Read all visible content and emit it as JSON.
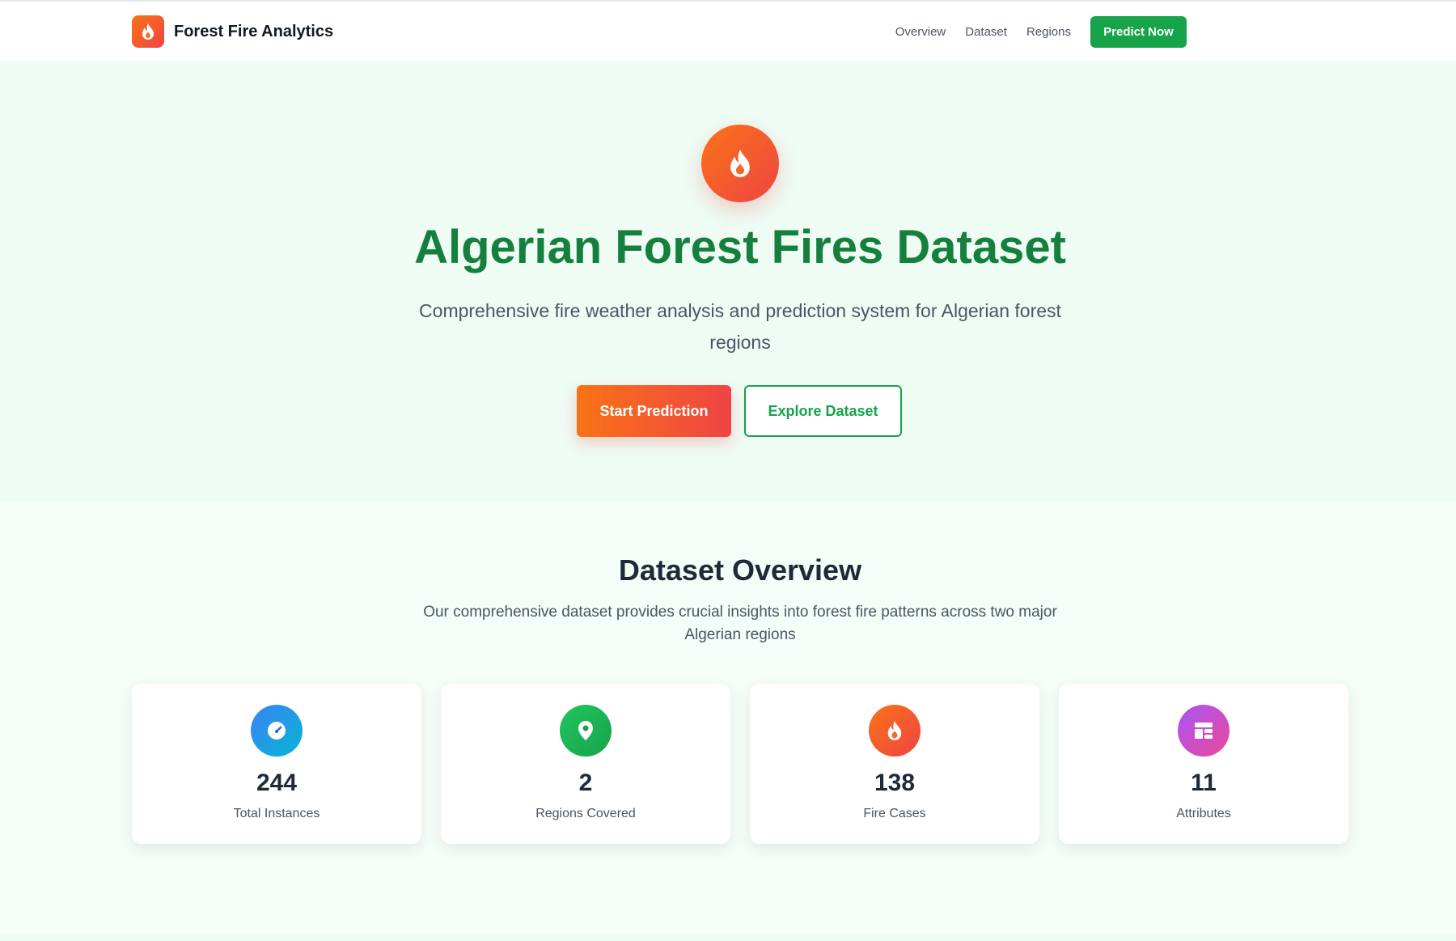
{
  "navbar": {
    "brand_name": "Forest Fire Analytics",
    "brand_icon": "flame-icon",
    "links": [
      {
        "label": "Overview"
      },
      {
        "label": "Dataset"
      },
      {
        "label": "Regions"
      }
    ],
    "cta_label": "Predict Now"
  },
  "hero": {
    "icon": "flame-icon",
    "title": "Algerian Forest Fires Dataset",
    "subtitle": "Comprehensive fire weather analysis and prediction system for Algerian forest regions",
    "primary_button": "Start Prediction",
    "secondary_button": "Explore Dataset"
  },
  "overview": {
    "title": "Dataset Overview",
    "subtitle": "Our comprehensive dataset provides crucial insights into forest fire patterns across two major Algerian regions",
    "stats": [
      {
        "value": "244",
        "label": "Total Instances",
        "icon": "gauge-icon",
        "color": "#3b82f6"
      },
      {
        "value": "2",
        "label": "Regions Covered",
        "icon": "map-pin-icon",
        "color": "#22c55e"
      },
      {
        "value": "138",
        "label": "Fire Cases",
        "icon": "flame-icon",
        "color": "#f97316"
      },
      {
        "value": "11",
        "label": "Attributes",
        "icon": "table-icon",
        "color": "#a855f7"
      }
    ]
  },
  "colors": {
    "brand_green": "#16a34a",
    "title_green": "#15803d",
    "fire_orange": "#f97316",
    "fire_red": "#ef4444"
  }
}
